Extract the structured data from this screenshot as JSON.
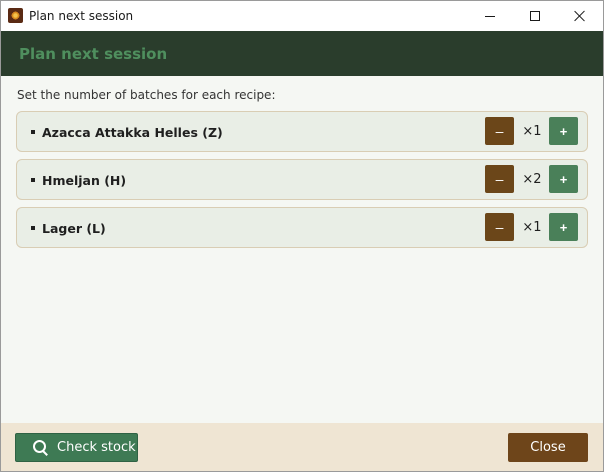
{
  "window": {
    "title": "Plan next session",
    "app_icon": "beer-barrel-app-icon",
    "controls": [
      "minimize-icon",
      "maximize-icon",
      "close-icon"
    ]
  },
  "header": {
    "title": "Plan next session"
  },
  "instruction": "Set the number of batches for each recipe:",
  "recipes": [
    {
      "name": "Azacca Attakka Helles (Z)",
      "count": "×1",
      "minus_label": "–",
      "plus_label": "+"
    },
    {
      "name": "Hmeljan (H)",
      "count": "×2",
      "minus_label": "–",
      "plus_label": "+"
    },
    {
      "name": "Lager (L)",
      "count": "×1",
      "minus_label": "–",
      "plus_label": "+"
    }
  ],
  "footer": {
    "check_stock_label": "Check stock",
    "check_stock_icon": "search-icon",
    "close_label": "Close"
  },
  "colors": {
    "header_bg": "#2a3d2c",
    "header_text": "#4f8f5e",
    "minus_button": "#6b4619",
    "plus_button": "#4a8059",
    "footer_bg": "#efe5d3",
    "check_stock_button": "#3e7a54",
    "close_button": "#6e451a"
  }
}
